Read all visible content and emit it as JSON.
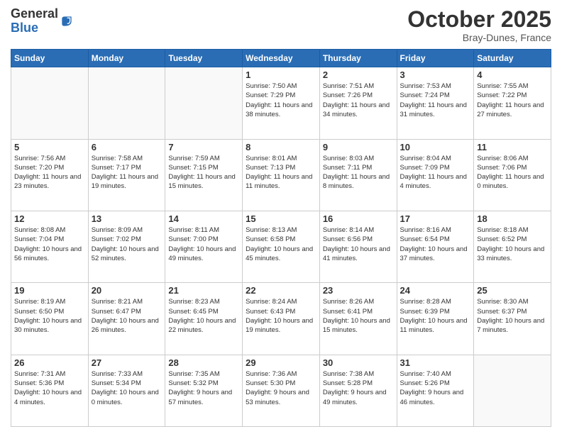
{
  "logo": {
    "general": "General",
    "blue": "Blue"
  },
  "header": {
    "month": "October 2025",
    "location": "Bray-Dunes, France"
  },
  "days": [
    "Sunday",
    "Monday",
    "Tuesday",
    "Wednesday",
    "Thursday",
    "Friday",
    "Saturday"
  ],
  "weeks": [
    [
      {
        "day": "",
        "sunrise": "",
        "sunset": "",
        "daylight": ""
      },
      {
        "day": "",
        "sunrise": "",
        "sunset": "",
        "daylight": ""
      },
      {
        "day": "",
        "sunrise": "",
        "sunset": "",
        "daylight": ""
      },
      {
        "day": "1",
        "sunrise": "Sunrise: 7:50 AM",
        "sunset": "Sunset: 7:29 PM",
        "daylight": "Daylight: 11 hours and 38 minutes."
      },
      {
        "day": "2",
        "sunrise": "Sunrise: 7:51 AM",
        "sunset": "Sunset: 7:26 PM",
        "daylight": "Daylight: 11 hours and 34 minutes."
      },
      {
        "day": "3",
        "sunrise": "Sunrise: 7:53 AM",
        "sunset": "Sunset: 7:24 PM",
        "daylight": "Daylight: 11 hours and 31 minutes."
      },
      {
        "day": "4",
        "sunrise": "Sunrise: 7:55 AM",
        "sunset": "Sunset: 7:22 PM",
        "daylight": "Daylight: 11 hours and 27 minutes."
      }
    ],
    [
      {
        "day": "5",
        "sunrise": "Sunrise: 7:56 AM",
        "sunset": "Sunset: 7:20 PM",
        "daylight": "Daylight: 11 hours and 23 minutes."
      },
      {
        "day": "6",
        "sunrise": "Sunrise: 7:58 AM",
        "sunset": "Sunset: 7:17 PM",
        "daylight": "Daylight: 11 hours and 19 minutes."
      },
      {
        "day": "7",
        "sunrise": "Sunrise: 7:59 AM",
        "sunset": "Sunset: 7:15 PM",
        "daylight": "Daylight: 11 hours and 15 minutes."
      },
      {
        "day": "8",
        "sunrise": "Sunrise: 8:01 AM",
        "sunset": "Sunset: 7:13 PM",
        "daylight": "Daylight: 11 hours and 11 minutes."
      },
      {
        "day": "9",
        "sunrise": "Sunrise: 8:03 AM",
        "sunset": "Sunset: 7:11 PM",
        "daylight": "Daylight: 11 hours and 8 minutes."
      },
      {
        "day": "10",
        "sunrise": "Sunrise: 8:04 AM",
        "sunset": "Sunset: 7:09 PM",
        "daylight": "Daylight: 11 hours and 4 minutes."
      },
      {
        "day": "11",
        "sunrise": "Sunrise: 8:06 AM",
        "sunset": "Sunset: 7:06 PM",
        "daylight": "Daylight: 11 hours and 0 minutes."
      }
    ],
    [
      {
        "day": "12",
        "sunrise": "Sunrise: 8:08 AM",
        "sunset": "Sunset: 7:04 PM",
        "daylight": "Daylight: 10 hours and 56 minutes."
      },
      {
        "day": "13",
        "sunrise": "Sunrise: 8:09 AM",
        "sunset": "Sunset: 7:02 PM",
        "daylight": "Daylight: 10 hours and 52 minutes."
      },
      {
        "day": "14",
        "sunrise": "Sunrise: 8:11 AM",
        "sunset": "Sunset: 7:00 PM",
        "daylight": "Daylight: 10 hours and 49 minutes."
      },
      {
        "day": "15",
        "sunrise": "Sunrise: 8:13 AM",
        "sunset": "Sunset: 6:58 PM",
        "daylight": "Daylight: 10 hours and 45 minutes."
      },
      {
        "day": "16",
        "sunrise": "Sunrise: 8:14 AM",
        "sunset": "Sunset: 6:56 PM",
        "daylight": "Daylight: 10 hours and 41 minutes."
      },
      {
        "day": "17",
        "sunrise": "Sunrise: 8:16 AM",
        "sunset": "Sunset: 6:54 PM",
        "daylight": "Daylight: 10 hours and 37 minutes."
      },
      {
        "day": "18",
        "sunrise": "Sunrise: 8:18 AM",
        "sunset": "Sunset: 6:52 PM",
        "daylight": "Daylight: 10 hours and 33 minutes."
      }
    ],
    [
      {
        "day": "19",
        "sunrise": "Sunrise: 8:19 AM",
        "sunset": "Sunset: 6:50 PM",
        "daylight": "Daylight: 10 hours and 30 minutes."
      },
      {
        "day": "20",
        "sunrise": "Sunrise: 8:21 AM",
        "sunset": "Sunset: 6:47 PM",
        "daylight": "Daylight: 10 hours and 26 minutes."
      },
      {
        "day": "21",
        "sunrise": "Sunrise: 8:23 AM",
        "sunset": "Sunset: 6:45 PM",
        "daylight": "Daylight: 10 hours and 22 minutes."
      },
      {
        "day": "22",
        "sunrise": "Sunrise: 8:24 AM",
        "sunset": "Sunset: 6:43 PM",
        "daylight": "Daylight: 10 hours and 19 minutes."
      },
      {
        "day": "23",
        "sunrise": "Sunrise: 8:26 AM",
        "sunset": "Sunset: 6:41 PM",
        "daylight": "Daylight: 10 hours and 15 minutes."
      },
      {
        "day": "24",
        "sunrise": "Sunrise: 8:28 AM",
        "sunset": "Sunset: 6:39 PM",
        "daylight": "Daylight: 10 hours and 11 minutes."
      },
      {
        "day": "25",
        "sunrise": "Sunrise: 8:30 AM",
        "sunset": "Sunset: 6:37 PM",
        "daylight": "Daylight: 10 hours and 7 minutes."
      }
    ],
    [
      {
        "day": "26",
        "sunrise": "Sunrise: 7:31 AM",
        "sunset": "Sunset: 5:36 PM",
        "daylight": "Daylight: 10 hours and 4 minutes."
      },
      {
        "day": "27",
        "sunrise": "Sunrise: 7:33 AM",
        "sunset": "Sunset: 5:34 PM",
        "daylight": "Daylight: 10 hours and 0 minutes."
      },
      {
        "day": "28",
        "sunrise": "Sunrise: 7:35 AM",
        "sunset": "Sunset: 5:32 PM",
        "daylight": "Daylight: 9 hours and 57 minutes."
      },
      {
        "day": "29",
        "sunrise": "Sunrise: 7:36 AM",
        "sunset": "Sunset: 5:30 PM",
        "daylight": "Daylight: 9 hours and 53 minutes."
      },
      {
        "day": "30",
        "sunrise": "Sunrise: 7:38 AM",
        "sunset": "Sunset: 5:28 PM",
        "daylight": "Daylight: 9 hours and 49 minutes."
      },
      {
        "day": "31",
        "sunrise": "Sunrise: 7:40 AM",
        "sunset": "Sunset: 5:26 PM",
        "daylight": "Daylight: 9 hours and 46 minutes."
      },
      {
        "day": "",
        "sunrise": "",
        "sunset": "",
        "daylight": ""
      }
    ]
  ]
}
